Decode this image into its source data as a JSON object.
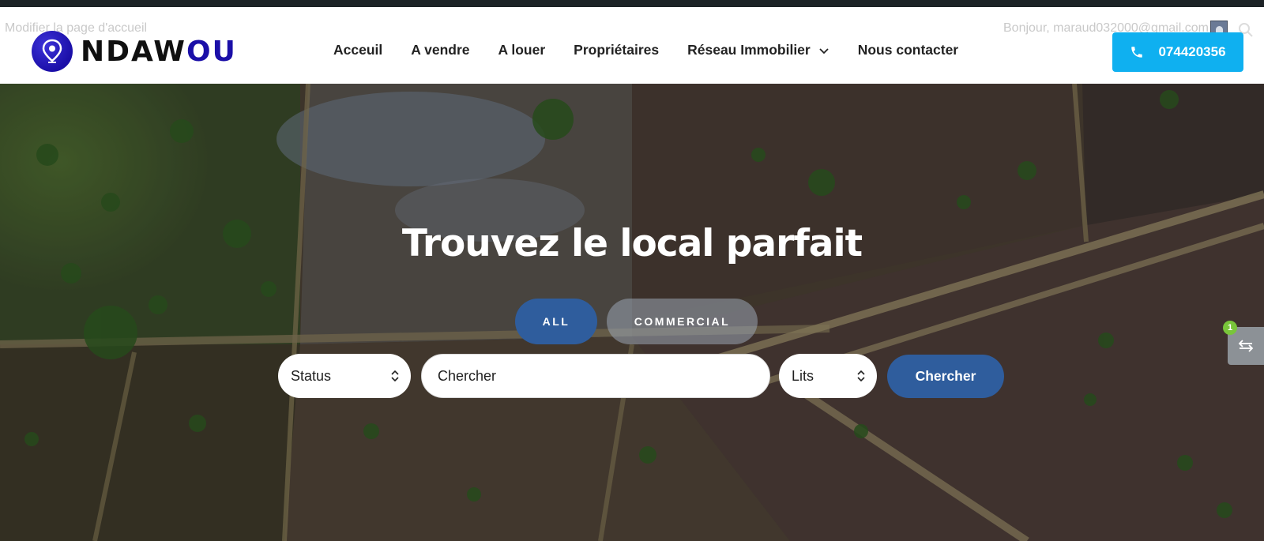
{
  "admin_bar": {
    "edit_homepage": "Modifier la page d'accueil",
    "greeting": "Bonjour, maraud032000@gmail.com"
  },
  "brand": {
    "name_dark": "NDAW",
    "name_accent": "OU",
    "logo_color": "#1b0fa8"
  },
  "nav": {
    "items": [
      {
        "label": "Acceuil"
      },
      {
        "label": "A vendre"
      },
      {
        "label": "A louer"
      },
      {
        "label": "Propriétaires"
      },
      {
        "label": "Réseau Immobilier",
        "has_dropdown": true
      },
      {
        "label": "Nous contacter"
      }
    ]
  },
  "phone": {
    "number": "074420356",
    "icon": "phone-icon",
    "color": "#0fb0f0"
  },
  "hero": {
    "title": "Trouvez le local parfait",
    "tabs": [
      {
        "label": "ALL",
        "active": true
      },
      {
        "label": "COMMERCIAL",
        "active": false
      }
    ],
    "search": {
      "status_label": "Status",
      "placeholder": "Chercher",
      "lits_label": "Lits",
      "button_label": "Chercher",
      "accent_color": "#2f5d9d"
    }
  },
  "compare": {
    "badge_count": "1",
    "icon": "arrows-exchange-icon"
  }
}
